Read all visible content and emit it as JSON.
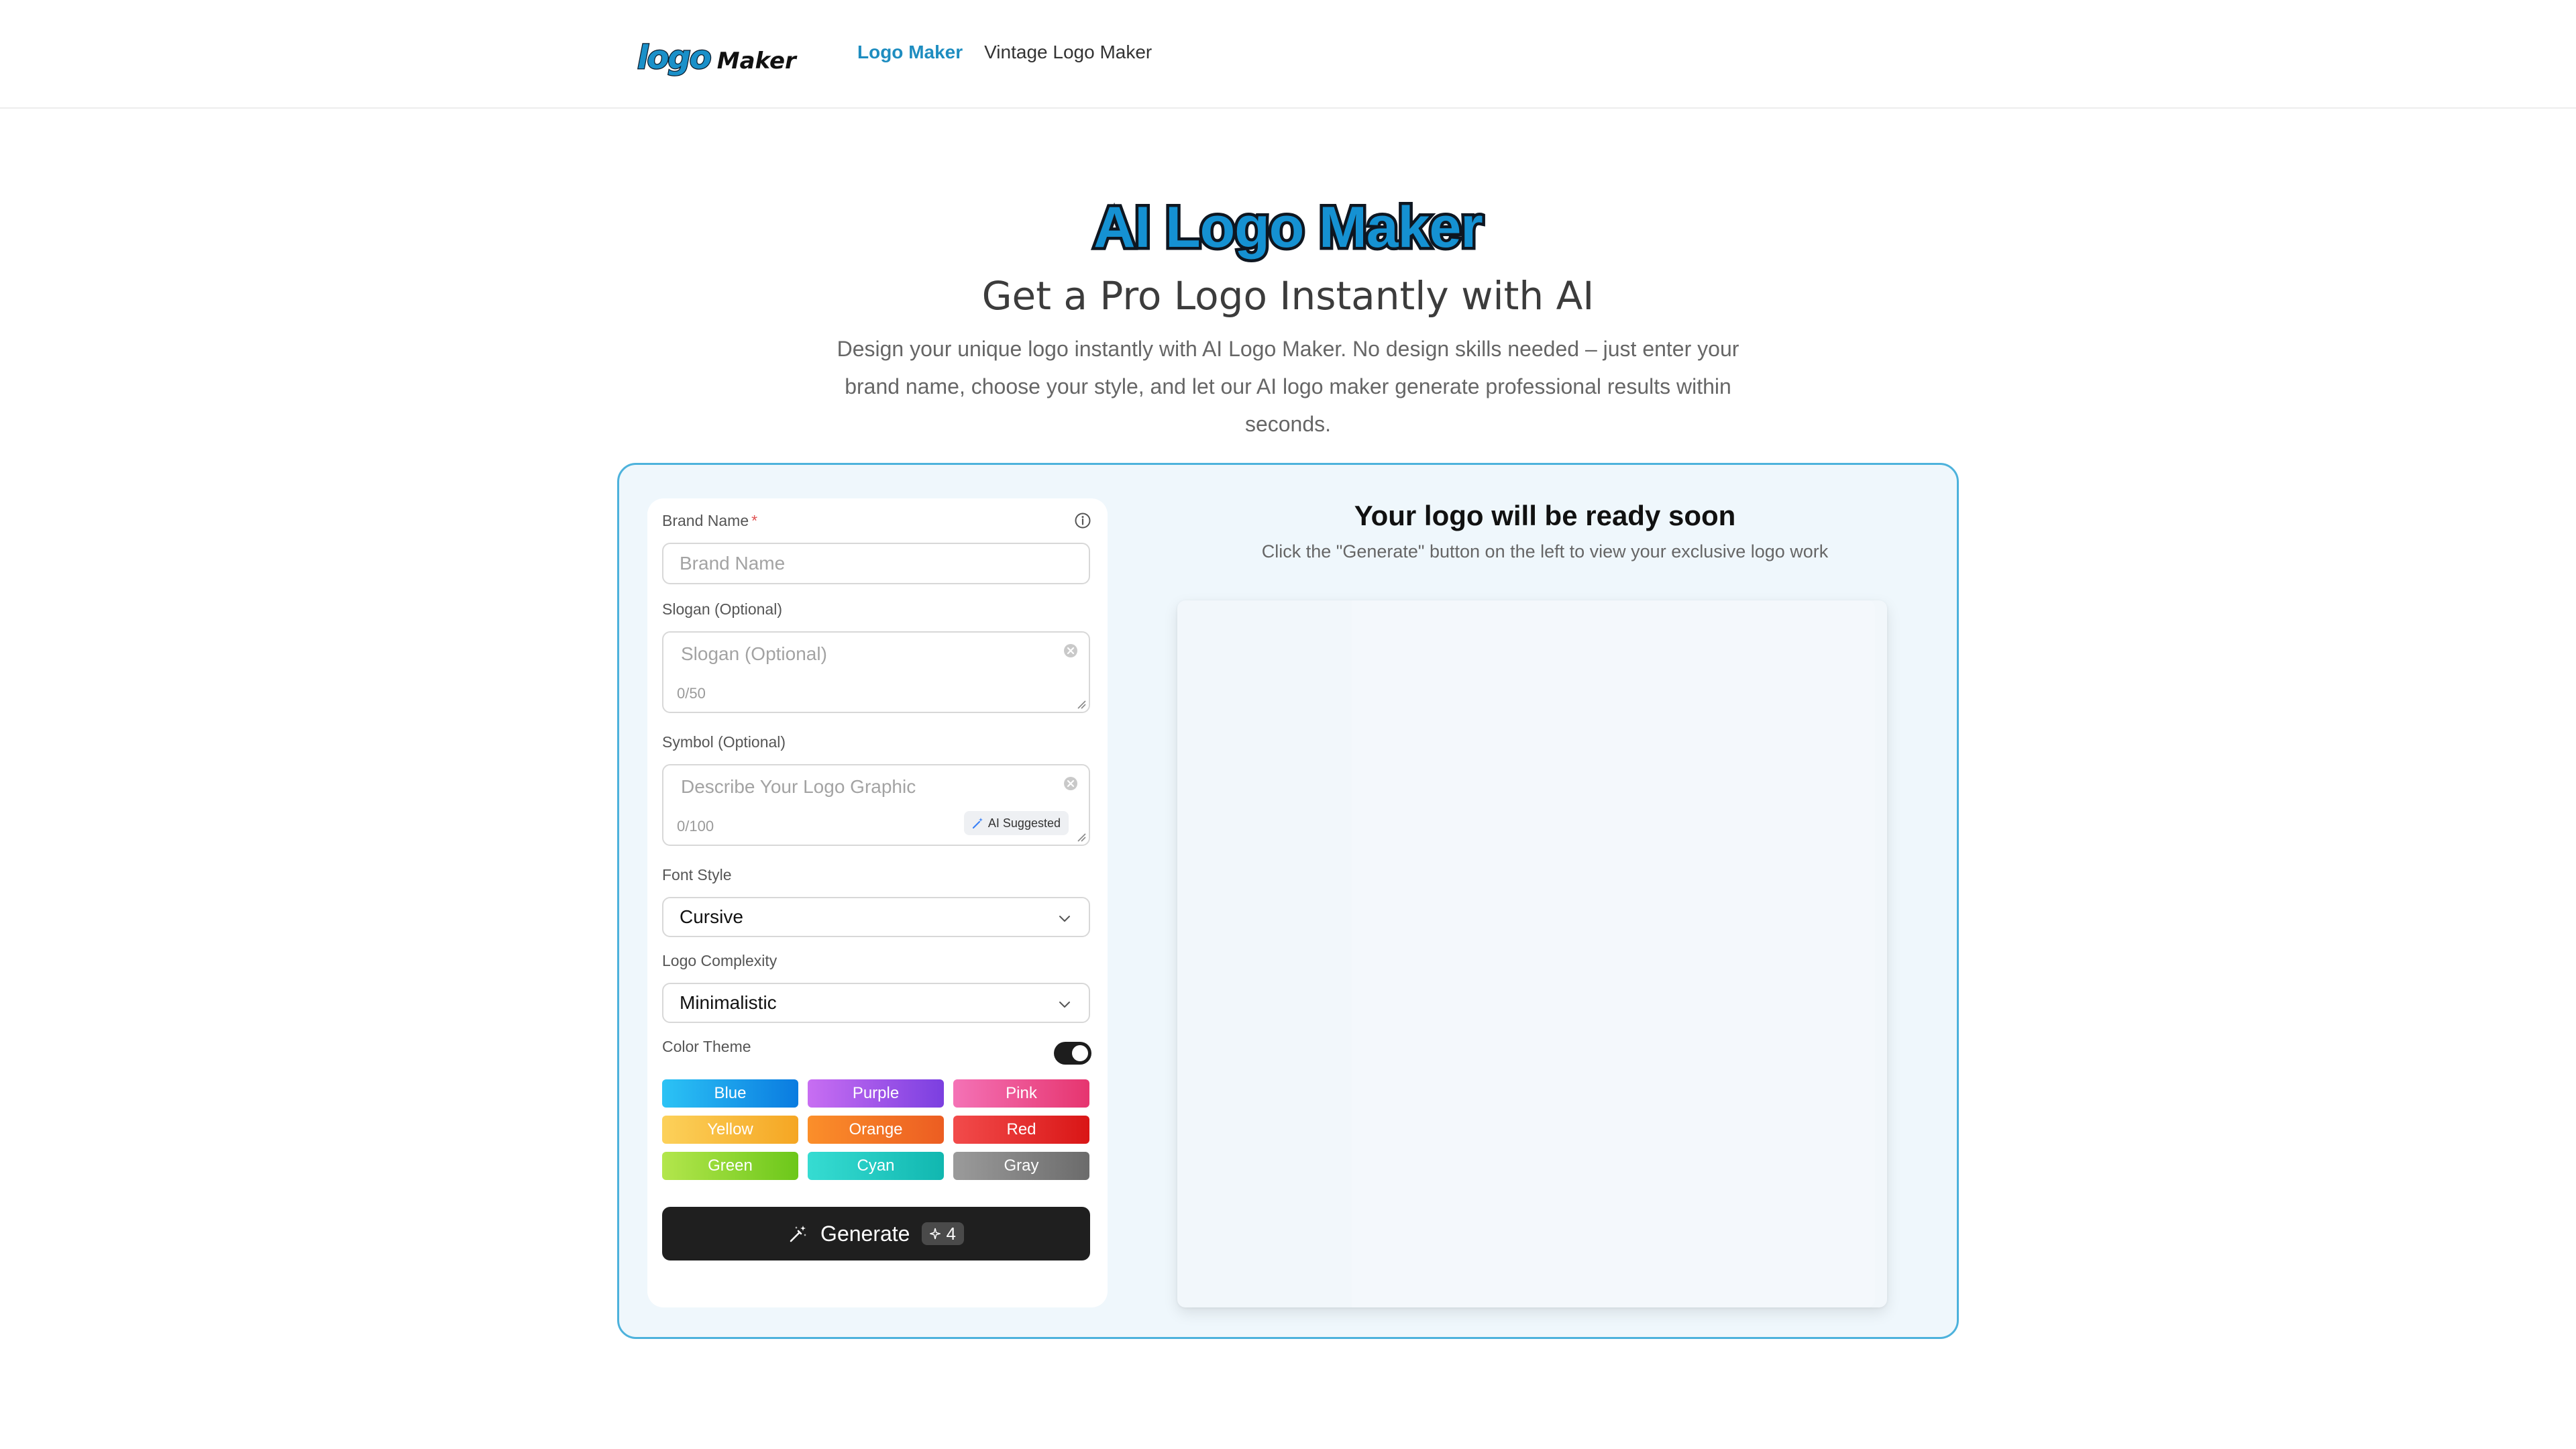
{
  "header": {
    "brand_logo_word": "logo",
    "brand_maker": "Maker",
    "nav": [
      {
        "label": "Logo Maker",
        "active": true
      },
      {
        "label": "Vintage Logo Maker",
        "active": false
      }
    ]
  },
  "hero": {
    "title": "AI Logo Maker",
    "subtitle": "Get a Pro Logo Instantly with AI",
    "description": "Design your unique logo instantly with AI Logo Maker. No design skills needed – just enter your brand name, choose your style, and let our AI logo maker generate professional results within seconds."
  },
  "form": {
    "brand_name": {
      "label": "Brand Name",
      "required_mark": "*",
      "placeholder": "Brand Name",
      "value": ""
    },
    "slogan": {
      "label": "Slogan (Optional)",
      "placeholder": "Slogan (Optional)",
      "counter": "0/50"
    },
    "symbol": {
      "label": "Symbol (Optional)",
      "placeholder": "Describe Your Logo Graphic",
      "counter": "0/100",
      "ai_suggested": "AI Suggested"
    },
    "font_style": {
      "label": "Font Style",
      "value": "Cursive"
    },
    "complexity": {
      "label": "Logo Complexity",
      "value": "Minimalistic"
    },
    "color_theme": {
      "label": "Color Theme",
      "toggle_on": true,
      "colors": [
        {
          "label": "Blue",
          "from": "#2cc3f5",
          "to": "#0a7be0"
        },
        {
          "label": "Purple",
          "from": "#c86ef2",
          "to": "#7b3fe0"
        },
        {
          "label": "Pink",
          "from": "#f472b6",
          "to": "#e6356f"
        },
        {
          "label": "Yellow",
          "from": "#fcd15a",
          "to": "#f5a623"
        },
        {
          "label": "Orange",
          "from": "#fb8f2a",
          "to": "#ec5d22"
        },
        {
          "label": "Red",
          "from": "#f24b4b",
          "to": "#d91616"
        },
        {
          "label": "Green",
          "from": "#b3e64c",
          "to": "#6cc71a"
        },
        {
          "label": "Cyan",
          "from": "#36dcd2",
          "to": "#11b7b0"
        },
        {
          "label": "Gray",
          "from": "#9b9b9b",
          "to": "#6b6b6b"
        }
      ]
    },
    "generate": {
      "label": "Generate",
      "credits": "4"
    }
  },
  "preview": {
    "title": "Your logo will be ready soon",
    "subtitle": "Click the \"Generate\" button on the left to view your exclusive logo work"
  }
}
